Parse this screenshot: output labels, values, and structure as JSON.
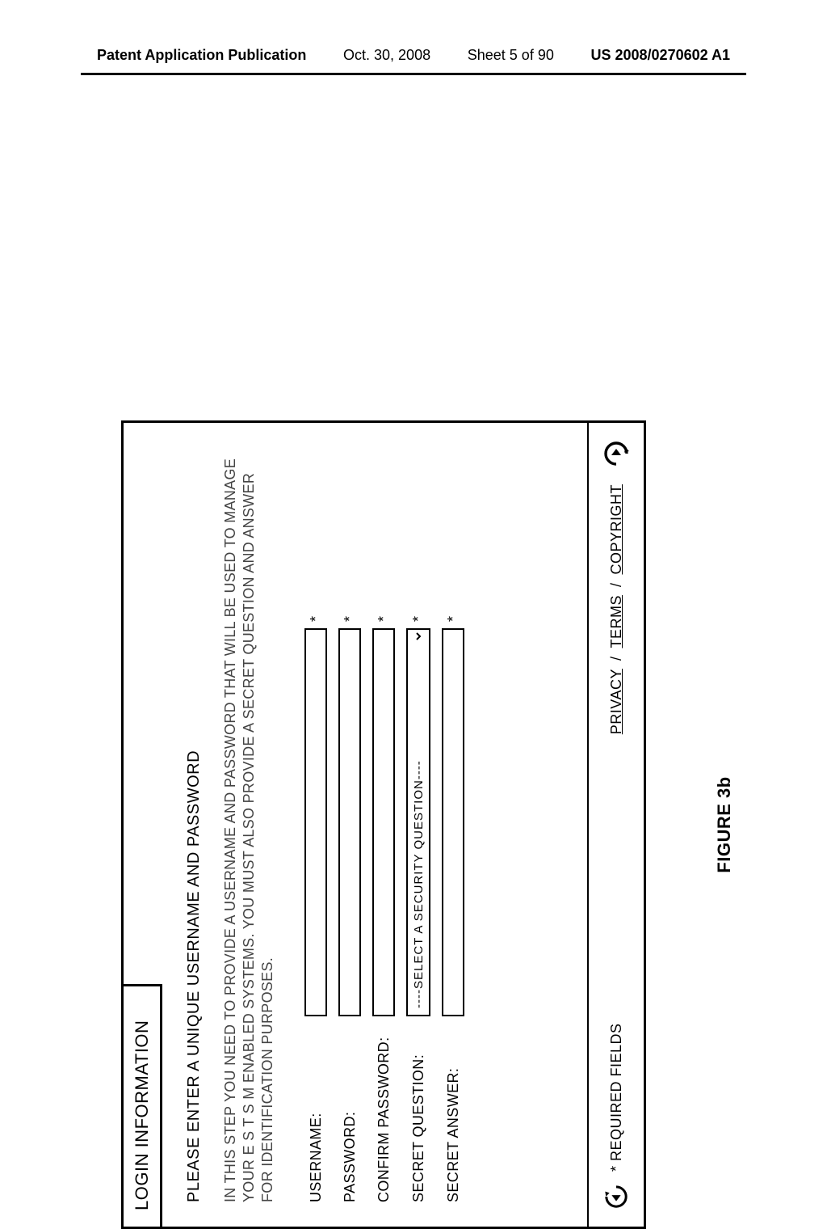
{
  "header": {
    "publication": "Patent Application Publication",
    "date": "Oct. 30, 2008",
    "sheet": "Sheet 5 of 90",
    "docno": "US 2008/0270602 A1"
  },
  "panel": {
    "title": "LOGIN INFORMATION",
    "subtitle": "PLEASE ENTER A UNIQUE USERNAME AND PASSWORD",
    "instructions": "IN THIS STEP YOU NEED TO PROVIDE A USERNAME AND PASSWORD THAT WILL BE USED TO MANAGE YOUR E S T S M ENABLED SYSTEMS. YOU MUST ALSO PROVIDE A SECRET QUESTION AND ANSWER FOR IDENTIFICATION PURPOSES.",
    "fields": {
      "username": {
        "label": "USERNAME:",
        "value": "",
        "required": "*"
      },
      "password": {
        "label": "PASSWORD:",
        "value": "",
        "required": "*"
      },
      "confirm": {
        "label": "CONFIRM PASSWORD:",
        "value": "",
        "required": "*"
      },
      "question": {
        "label": "SECRET QUESTION:",
        "placeholder": "----SELECT A SECURITY QUESTION----",
        "required": "*"
      },
      "answer": {
        "label": "SECRET ANSWER:",
        "value": "",
        "required": "*"
      }
    },
    "footer": {
      "required_note": "* REQUIRED FIELDS",
      "links": {
        "privacy": "PRIVACY",
        "terms": "TERMS",
        "copyright": "COPYRIGHT",
        "sep": "/"
      }
    }
  },
  "caption": "FIGURE 3b"
}
